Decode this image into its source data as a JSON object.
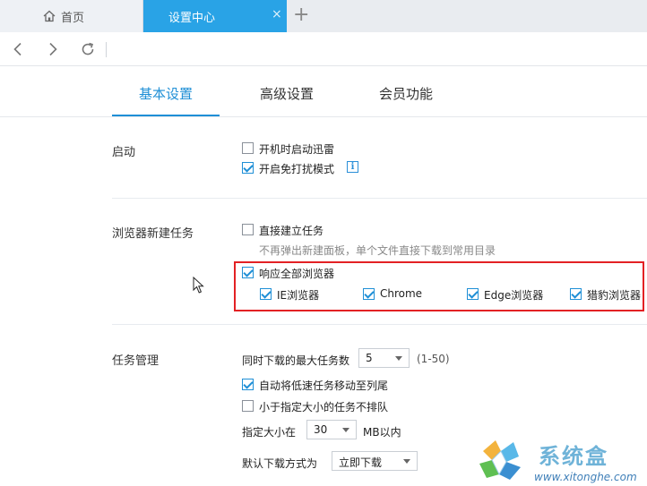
{
  "tabs": {
    "home_label": "首页",
    "active_label": "设置中心",
    "close_glyph": "×",
    "new_tab_glyph": "+"
  },
  "nav": {
    "back_icon": "chevron-left-icon",
    "forward_icon": "chevron-right-icon",
    "refresh_icon": "refresh-icon"
  },
  "settings_tabs": [
    {
      "label": "基本设置",
      "active": true
    },
    {
      "label": "高级设置",
      "active": false
    },
    {
      "label": "会员功能",
      "active": false
    }
  ],
  "startup": {
    "label": "启动",
    "options": [
      {
        "label": "开机时启动迅雷",
        "checked": false
      },
      {
        "label": "开启免打扰模式",
        "checked": true
      }
    ],
    "info_glyph": "i"
  },
  "browser_task": {
    "label": "浏览器新建任务",
    "direct": {
      "label": "直接建立任务",
      "checked": false
    },
    "direct_hint": "不再弹出新建面板，单个文件直接下载到常用目录",
    "respond_all": {
      "label": "响应全部浏览器",
      "checked": true
    },
    "browsers": [
      {
        "label": "IE浏览器",
        "checked": true
      },
      {
        "label": "Chrome",
        "checked": true
      },
      {
        "label": "Edge浏览器",
        "checked": true
      },
      {
        "label": "猎豹浏览器",
        "checked": true
      }
    ],
    "highlight_color": "#e32124"
  },
  "task_management": {
    "label": "任务管理",
    "max_tasks_label": "同时下载的最大任务数",
    "max_tasks_value": "5",
    "max_tasks_range": "(1-50)",
    "auto_move": {
      "label": "自动将低速任务移动至列尾",
      "checked": true
    },
    "small_no_queue": {
      "label": "小于指定大小的任务不排队",
      "checked": false
    },
    "size_label": "指定大小在",
    "size_value": "30",
    "size_unit": "MB以内",
    "default_mode_label": "默认下载方式为",
    "default_mode_value": "立即下载"
  },
  "watermark": {
    "title": "系统盒",
    "url": "www.xitonghe.com"
  },
  "colors": {
    "accent": "#29a3e6",
    "link_blue": "#1f8fd6"
  }
}
